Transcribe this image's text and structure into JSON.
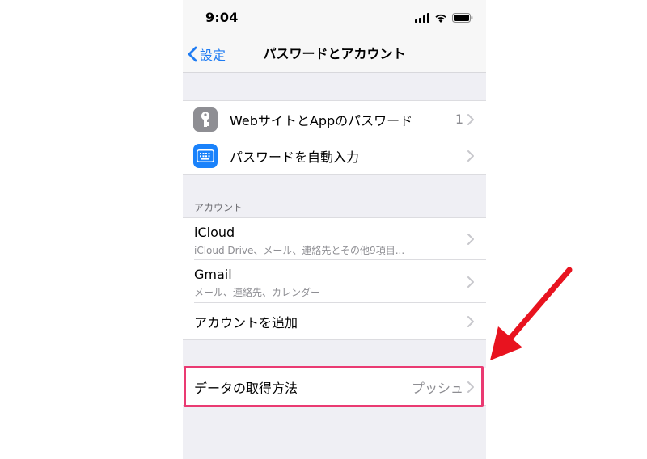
{
  "status": {
    "time": "9:04"
  },
  "nav": {
    "back_label": "設定",
    "title": "パスワードとアカウント"
  },
  "passwords_group": {
    "items": [
      {
        "label": "WebサイトとAppのパスワード",
        "value": "1",
        "icon": "key-icon",
        "icon_color": "#8e8e93"
      },
      {
        "label": "パスワードを自動入力",
        "icon": "keyboard-icon",
        "icon_color": "#1a82fb"
      }
    ]
  },
  "accounts_section": {
    "header": "アカウント",
    "items": [
      {
        "title": "iCloud",
        "subtitle": "iCloud Drive、メール、連絡先とその他9項目..."
      },
      {
        "title": "Gmail",
        "subtitle": "メール、連絡先、カレンダー"
      },
      {
        "title": "アカウントを追加"
      }
    ]
  },
  "fetch_group": {
    "label": "データの取得方法",
    "value": "プッシュ"
  },
  "colors": {
    "accent": "#1f7cf3",
    "highlight": "#ea3a72",
    "arrow": "#e8131f"
  }
}
